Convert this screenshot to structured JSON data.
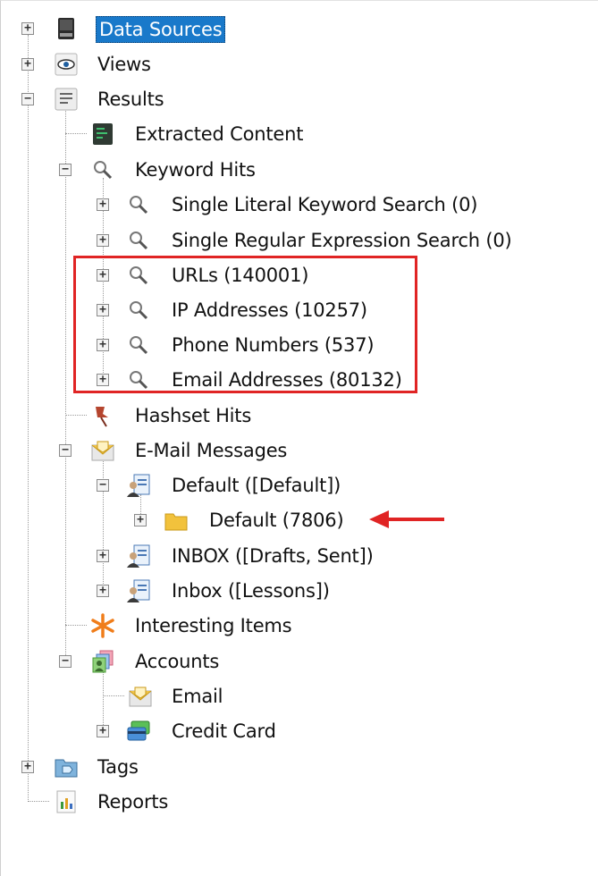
{
  "tree": {
    "data_sources": "Data Sources",
    "views": "Views",
    "results": "Results",
    "extracted_content": "Extracted Content",
    "keyword_hits": "Keyword Hits",
    "single_literal": "Single Literal Keyword Search (0)",
    "single_regex": "Single Regular Expression Search (0)",
    "urls": "URLs (140001)",
    "ip_addresses": "IP Addresses (10257)",
    "phone_numbers": "Phone Numbers (537)",
    "email_addresses": "Email Addresses (80132)",
    "hashset_hits": "Hashset Hits",
    "email_messages": "E-Mail Messages",
    "default_account": "Default ([Default])",
    "default_folder": "Default (7806)",
    "inbox_drafts": "INBOX ([Drafts, Sent])",
    "inbox_lessons": "Inbox ([Lessons])",
    "interesting_items": "Interesting Items",
    "accounts": "Accounts",
    "email": "Email",
    "credit_card": "Credit Card",
    "tags": "Tags",
    "reports": "Reports"
  },
  "expander": {
    "plus": "+",
    "minus": "−"
  },
  "colors": {
    "selection": "#1979ca",
    "highlight_box": "#e02424",
    "arrow": "#e02424"
  }
}
